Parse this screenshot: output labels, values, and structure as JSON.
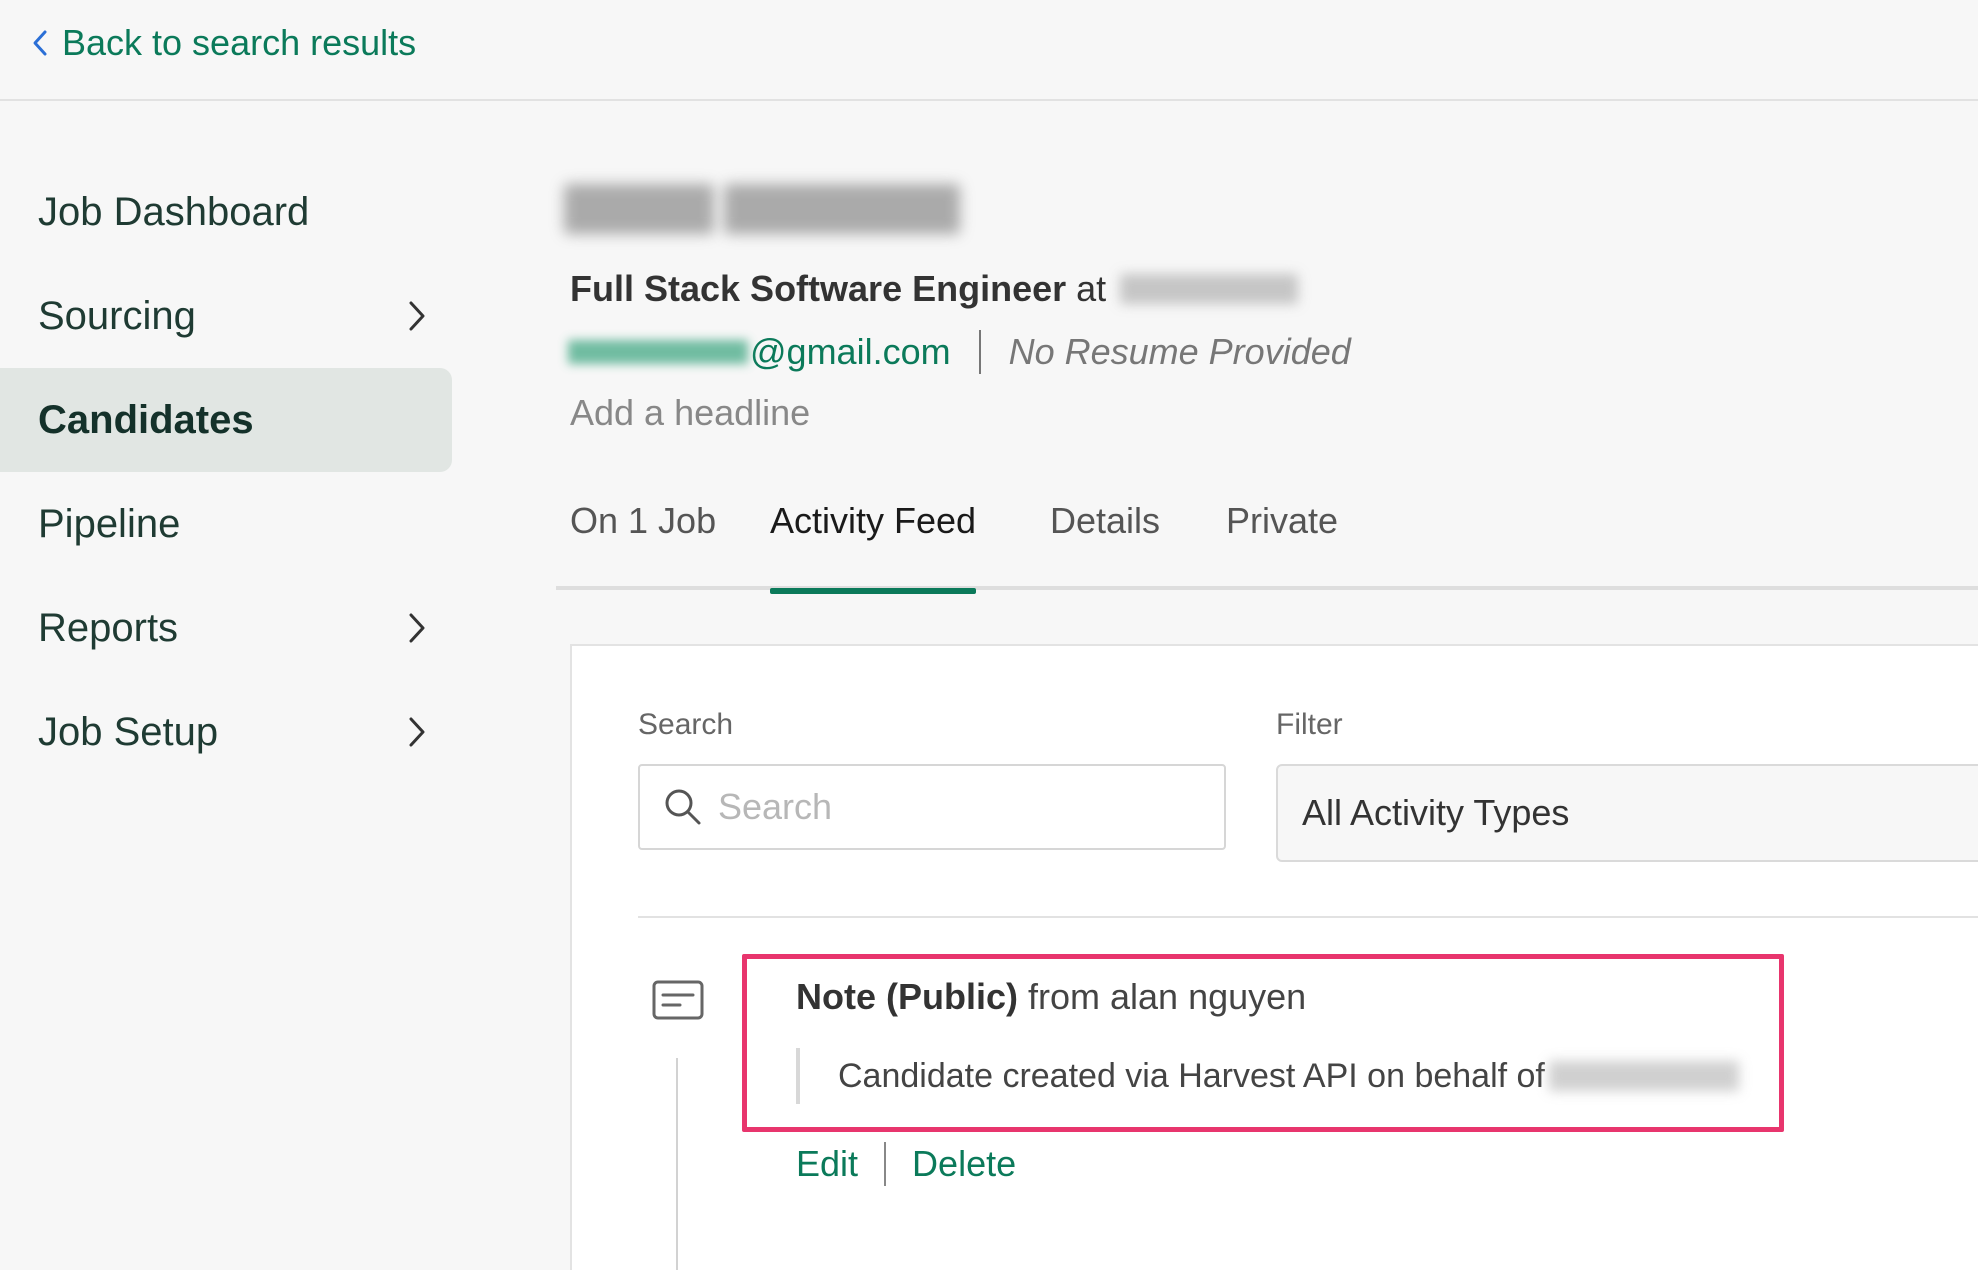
{
  "topbar": {
    "back_label": "Back to search results"
  },
  "sidebar": {
    "items": [
      {
        "label": "Job Dashboard",
        "has_chevron": false,
        "active": false
      },
      {
        "label": "Sourcing",
        "has_chevron": true,
        "active": false
      },
      {
        "label": "Candidates",
        "has_chevron": false,
        "active": true
      },
      {
        "label": "Pipeline",
        "has_chevron": false,
        "active": false
      },
      {
        "label": "Reports",
        "has_chevron": true,
        "active": false
      },
      {
        "label": "Job Setup",
        "has_chevron": true,
        "active": false
      }
    ]
  },
  "candidate": {
    "job_title": "Full Stack Software Engineer",
    "at_label": "at",
    "email_suffix": "@gmail.com",
    "resume_status": "No Resume Provided",
    "headline_placeholder": "Add a headline"
  },
  "tabs": [
    {
      "label": "On 1 Job",
      "active": false
    },
    {
      "label": "Activity Feed",
      "active": true
    },
    {
      "label": "Details",
      "active": false
    },
    {
      "label": "Private",
      "active": false
    }
  ],
  "feed": {
    "search_label": "Search",
    "search_placeholder": "Search",
    "filter_label": "Filter",
    "filter_value": "All Activity Types",
    "note": {
      "title": "Note (Public)",
      "author_text": "from alan nguyen",
      "body": "Candidate created via Harvest API on behalf of",
      "edit_label": "Edit",
      "delete_label": "Delete"
    }
  },
  "colors": {
    "accent": "#0b7a5a",
    "highlight": "#e8356d",
    "active_nav_bg": "#e1e6e3"
  }
}
